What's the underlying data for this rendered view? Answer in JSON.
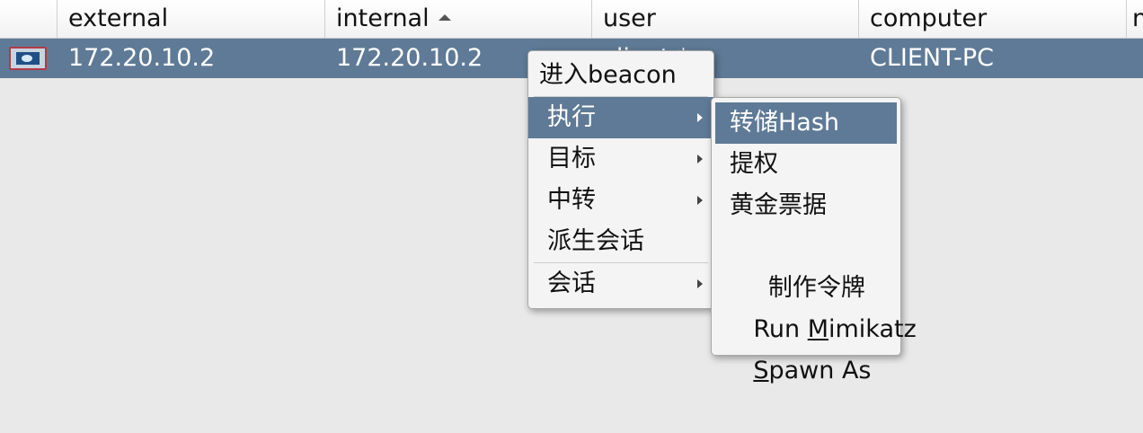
{
  "columns": [
    {
      "label": ""
    },
    {
      "label": "external"
    },
    {
      "label": "internal"
    },
    {
      "label": "user"
    },
    {
      "label": "computer"
    },
    {
      "label": "n"
    }
  ],
  "sort": {
    "column": "internal",
    "direction": "ascending"
  },
  "rows": [
    {
      "icon": "windows-beacon-icon",
      "external": "172.20.10.2",
      "internal": "172.20.10.2",
      "user": "client *",
      "computer": "CLIENT-PC"
    }
  ],
  "context_menu": {
    "items": [
      {
        "label": "进入beacon"
      },
      {
        "label": "执行",
        "submenu": true,
        "highlighted": true
      },
      {
        "label": "目标",
        "submenu": true
      },
      {
        "label": "中转",
        "submenu": true
      },
      {
        "label": "派生会话"
      },
      {
        "label": "会话",
        "submenu": true
      }
    ]
  },
  "submenu": {
    "items": [
      {
        "label": "转储Hash",
        "highlighted": true
      },
      {
        "label": "提权"
      },
      {
        "label": "黄金票据"
      },
      {
        "label": " 制作令牌"
      },
      {
        "label_pre": "Run ",
        "mnemonic": "M",
        "label_post": "imikatz"
      },
      {
        "label_pre": "",
        "mnemonic": "S",
        "label_post": "pawn As"
      }
    ]
  },
  "colors": {
    "selection": "#5f7a96",
    "background": "#e9e9e9",
    "menu_background": "#f4f4f4"
  }
}
